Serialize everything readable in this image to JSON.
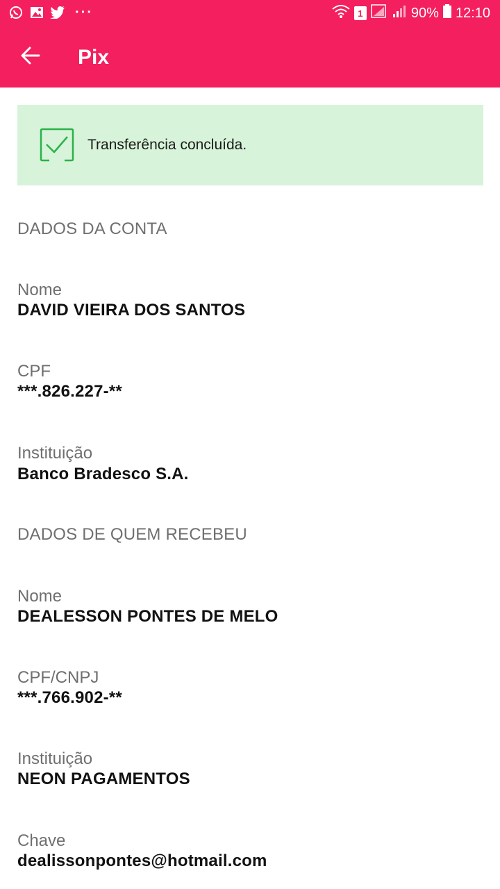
{
  "status_bar": {
    "icons": [
      "whatsapp-icon",
      "gallery-icon",
      "twitter-icon"
    ],
    "more": "···",
    "sim_badge": "1",
    "battery": "90%",
    "time": "12:10"
  },
  "toolbar": {
    "title": "Pix",
    "back_icon": "arrow-left-icon"
  },
  "success": {
    "message": "Transferência concluída.",
    "icon": "check-box-icon",
    "background": "#d7f3d9",
    "accent": "#2ab24a"
  },
  "colors": {
    "brand": "#f41f5e"
  },
  "account": {
    "section_title": "DADOS DA CONTA",
    "name_label": "Nome",
    "name_value": "DAVID VIEIRA DOS SANTOS",
    "cpf_label": "CPF",
    "cpf_value": "***.826.227-**",
    "institution_label": "Instituição",
    "institution_value": "Banco Bradesco S.A."
  },
  "receiver": {
    "section_title": "DADOS DE QUEM RECEBEU",
    "name_label": "Nome",
    "name_value": "DEALESSON PONTES DE MELO",
    "doc_label": "CPF/CNPJ",
    "doc_value": "***.766.902-**",
    "institution_label": "Instituição",
    "institution_value": "NEON PAGAMENTOS",
    "key_label": "Chave",
    "key_value": "dealissonpontes@hotmail.com"
  }
}
